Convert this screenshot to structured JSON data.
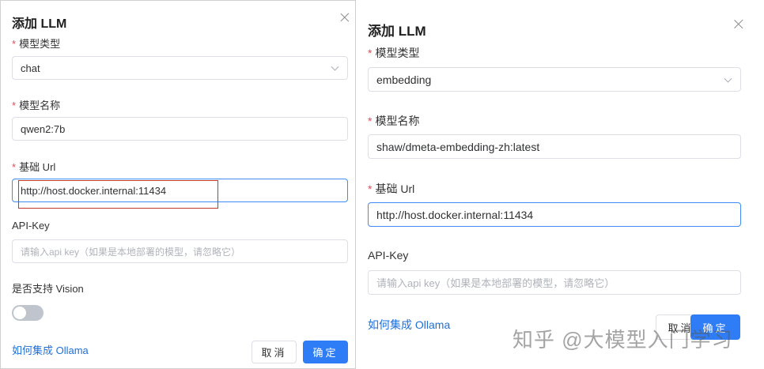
{
  "left_dialog": {
    "title": "添加 LLM",
    "model_type_label": "模型类型",
    "model_type_value": "chat",
    "model_name_label": "模型名称",
    "model_name_value": "qwen2:7b",
    "base_url_label": "基础 Url",
    "base_url_value": "http://host.docker.internal:11434",
    "api_key_label": "API-Key",
    "api_key_placeholder": "请输入api key（如果是本地部署的模型，请忽略它）",
    "vision_label": "是否支持 Vision",
    "vision_enabled": false,
    "ollama_link": "如何集成 Ollama",
    "cancel_label": "取消",
    "ok_label": "确定"
  },
  "right_dialog": {
    "title": "添加 LLM",
    "model_type_label": "模型类型",
    "model_type_value": "embedding",
    "model_name_label": "模型名称",
    "model_name_value": "shaw/dmeta-embedding-zh:latest",
    "base_url_label": "基础 Url",
    "base_url_value": "http://host.docker.internal:11434",
    "api_key_label": "API-Key",
    "api_key_placeholder": "请输入api key（如果是本地部署的模型，请忽略它）",
    "ollama_link": "如何集成 Ollama",
    "cancel_label": "取消",
    "ok_label": "确定"
  },
  "required_mark": "*",
  "watermark": "知乎 @大模型入门学习",
  "colors": {
    "primary": "#2f7df6",
    "link": "#1e6fd9",
    "required": "#e34d59",
    "highlight": "#c0392b",
    "focus_border": "#3f8cf5"
  }
}
